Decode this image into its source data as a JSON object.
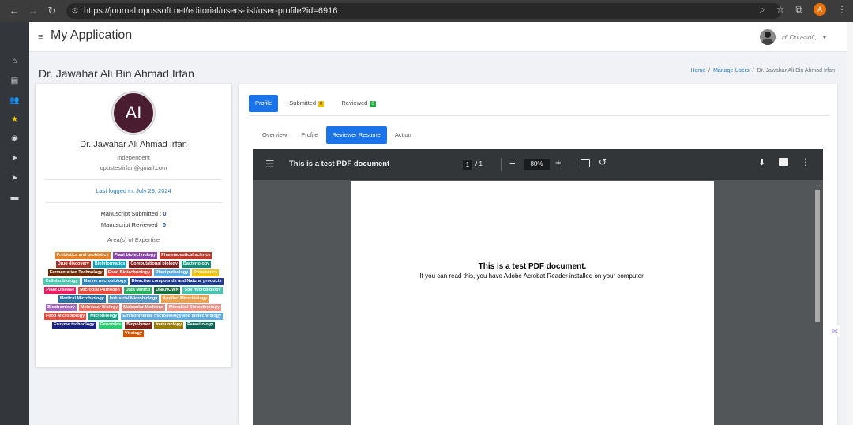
{
  "browser": {
    "url": "https://journal.opussoft.net/editorial/users-list/user-profile?id=6916",
    "profile_initial": "A"
  },
  "app": {
    "title": "My Application",
    "greeting": "Hi Opussoft,"
  },
  "page": {
    "title": "Dr. Jawahar Ali Bin Ahmad Irfan",
    "breadcrumb": {
      "home": "Home",
      "manage_users": "Manage Users",
      "current": "Dr. Jawahar Ali Bin Ahmad Irfan"
    }
  },
  "profile": {
    "initials": "AI",
    "name": "Dr. Jawahar Ali Ahmad Irfan",
    "institution": "Independent",
    "email": "opustestirfan@gmail.com",
    "last_logged_in": "Last logged in: July 29, 2024",
    "manuscript_submitted_label": "Manuscript Submitted :",
    "manuscript_submitted_count": "0",
    "manuscript_reviewed_label": "Manuscript Reviewed :",
    "manuscript_reviewed_count": "0",
    "areas_label": "Area(s) of Expertise",
    "tags": [
      {
        "label": "Prebiotics and probiotics",
        "color": "#e67e22"
      },
      {
        "label": "Plant biotechnology",
        "color": "#8e44ad"
      },
      {
        "label": "Pharmaceutical science",
        "color": "#c0392b"
      },
      {
        "label": "Drug discovery",
        "color": "#a93226"
      },
      {
        "label": "Bioinformatics",
        "color": "#17a2b8"
      },
      {
        "label": "Computational biology",
        "color": "#7b1f1f"
      },
      {
        "label": "Bacteriology",
        "color": "#138d75"
      },
      {
        "label": "Fermentation Technology",
        "color": "#6e2c00"
      },
      {
        "label": "Food Biotechnology",
        "color": "#e74c3c"
      },
      {
        "label": "Plant pathology",
        "color": "#5dade2"
      },
      {
        "label": "Proteomics",
        "color": "#f1c40f"
      },
      {
        "label": "Cellular biology",
        "color": "#48c9b0"
      },
      {
        "label": "Marine microbiology",
        "color": "#2e86c1"
      },
      {
        "label": "Bioactive compounds and Natural products",
        "color": "#1f3a93"
      },
      {
        "label": "Plant Disease",
        "color": "#e91e63"
      },
      {
        "label": "Microbial Pathogen",
        "color": "#e74c3c"
      },
      {
        "label": "Data Mining",
        "color": "#27ae60"
      },
      {
        "label": "UNKNOWN",
        "color": "#196f3d"
      },
      {
        "label": "Soil microbiology",
        "color": "#45c4b0"
      },
      {
        "label": "Medical Microbiology",
        "color": "#2874a6"
      },
      {
        "label": "Industrial Microbiology",
        "color": "#5499c7"
      },
      {
        "label": "Applied Microbiology",
        "color": "#f0a04b"
      },
      {
        "label": "Biochemistry",
        "color": "#a569bd"
      },
      {
        "label": "Molecular Biology",
        "color": "#ec7063"
      },
      {
        "label": "Molecular Medicine",
        "color": "#d98880"
      },
      {
        "label": "Microbial Biotechnology",
        "color": "#f1948a"
      },
      {
        "label": "Food Microbiology",
        "color": "#e74c3c"
      },
      {
        "label": "Microbiology",
        "color": "#16a085"
      },
      {
        "label": "Environmental microbiology and biotechnology",
        "color": "#5dade2"
      },
      {
        "label": "Enzyme technology",
        "color": "#1a237e"
      },
      {
        "label": "Genomics",
        "color": "#2ecc71"
      },
      {
        "label": "Biopolymer",
        "color": "#7b241c"
      },
      {
        "label": "Immunology",
        "color": "#9a7d0a"
      },
      {
        "label": "Parasitology",
        "color": "#0e6655"
      },
      {
        "label": "Virology",
        "color": "#d35400"
      }
    ]
  },
  "tabs": {
    "profile": "Profile",
    "submitted": "Submitted",
    "submitted_count": "0",
    "reviewed": "Reviewed",
    "reviewed_count": "0"
  },
  "subtabs": {
    "overview": "Overview",
    "profile": "Profile",
    "reviewer_resume": "Reviewer Resume",
    "action": "Action"
  },
  "pdf": {
    "title": "This is a test PDF document",
    "page_current": "1",
    "page_total": "/ 1",
    "zoom": "80%",
    "heading": "This is a test PDF document.",
    "body": "If you can read this, you have Adobe Acrobat Reader installed on your computer."
  }
}
